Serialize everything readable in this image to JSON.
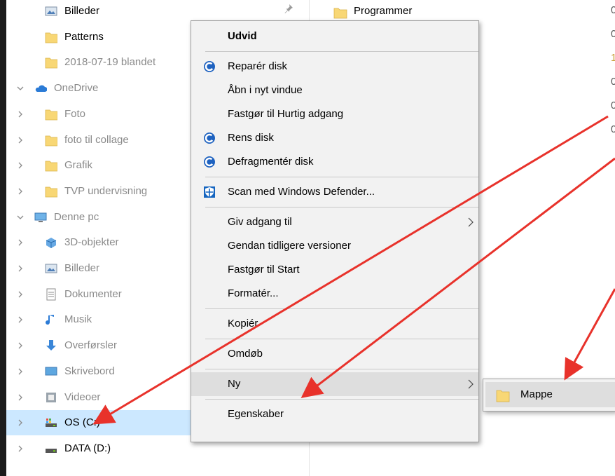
{
  "nav": {
    "items": [
      {
        "label": "Billeder",
        "icon": "pictures-folder-icon",
        "chevron": false,
        "dim": false,
        "pinned": true
      },
      {
        "label": "Patterns",
        "icon": "folder-icon",
        "chevron": false,
        "dim": false
      },
      {
        "label": "2018-07-19 blandet",
        "icon": "folder-icon",
        "chevron": false,
        "dim": true
      },
      {
        "label": "OneDrive",
        "icon": "cloud-icon",
        "chevron": "down",
        "dim": true
      },
      {
        "label": "Foto",
        "icon": "folder-icon",
        "chevron": "right",
        "dim": true
      },
      {
        "label": "foto til collage",
        "icon": "folder-icon",
        "chevron": "right",
        "dim": true
      },
      {
        "label": "Grafik",
        "icon": "folder-icon",
        "chevron": "right",
        "dim": true
      },
      {
        "label": "TVP undervisning",
        "icon": "folder-icon",
        "chevron": "right",
        "dim": true
      },
      {
        "label": "Denne pc",
        "icon": "computer-icon",
        "chevron": "down",
        "dim": true
      },
      {
        "label": "3D-objekter",
        "icon": "3d-objects-icon",
        "chevron": "right",
        "dim": true
      },
      {
        "label": "Billeder",
        "icon": "pictures-folder-icon",
        "chevron": "right",
        "dim": true
      },
      {
        "label": "Dokumenter",
        "icon": "documents-icon",
        "chevron": "right",
        "dim": true
      },
      {
        "label": "Musik",
        "icon": "music-icon",
        "chevron": "right",
        "dim": true
      },
      {
        "label": "Overførsler",
        "icon": "downloads-icon",
        "chevron": "right",
        "dim": true
      },
      {
        "label": "Skrivebord",
        "icon": "desktop-icon",
        "chevron": "right",
        "dim": true
      },
      {
        "label": "Videoer",
        "icon": "videos-icon",
        "chevron": "right",
        "dim": true
      },
      {
        "label": "OS (C:)",
        "icon": "system-drive-icon",
        "chevron": "right",
        "dim": false,
        "selected": true
      },
      {
        "label": "DATA (D:)",
        "icon": "drive-icon",
        "chevron": "right",
        "dim": false
      }
    ]
  },
  "content": {
    "folder_label": "Programmer",
    "folder_icon": "folder-icon",
    "right_edge_glyphs": [
      "0",
      "0",
      "1",
      "0",
      "0",
      "0"
    ]
  },
  "menu": {
    "items": [
      {
        "label": "Udvid",
        "bold": true
      },
      {
        "separator": true
      },
      {
        "label": "Reparér disk",
        "icon": "ccleaner-icon"
      },
      {
        "label": "Åbn i nyt vindue"
      },
      {
        "label": "Fastgør til Hurtig adgang"
      },
      {
        "label": "Rens disk",
        "icon": "ccleaner-icon"
      },
      {
        "label": "Defragmentér disk",
        "icon": "ccleaner-icon"
      },
      {
        "separator": true
      },
      {
        "label": "Scan med Windows Defender...",
        "icon": "windows-defender-icon"
      },
      {
        "separator": true
      },
      {
        "label": "Giv adgang til",
        "submenu": true
      },
      {
        "label": "Gendan tidligere versioner"
      },
      {
        "label": "Fastgør til Start"
      },
      {
        "label": "Formatér..."
      },
      {
        "separator": true
      },
      {
        "label": "Kopiér"
      },
      {
        "separator": true
      },
      {
        "label": "Omdøb"
      },
      {
        "separator": true
      },
      {
        "label": "Ny",
        "submenu": true,
        "highlighted": true
      },
      {
        "separator": true
      },
      {
        "label": "Egenskaber"
      }
    ]
  },
  "submenu": {
    "label": "Mappe",
    "icon": "folder-icon"
  },
  "colors": {
    "selection": "#cce8ff",
    "menu_bg": "#f2f2f2",
    "menu_highlight": "#dedede",
    "folder": "#f8d775",
    "annotation_arrow": "#e8322b",
    "ccleaner": "#1e62c0",
    "defender": "#1565c0"
  }
}
